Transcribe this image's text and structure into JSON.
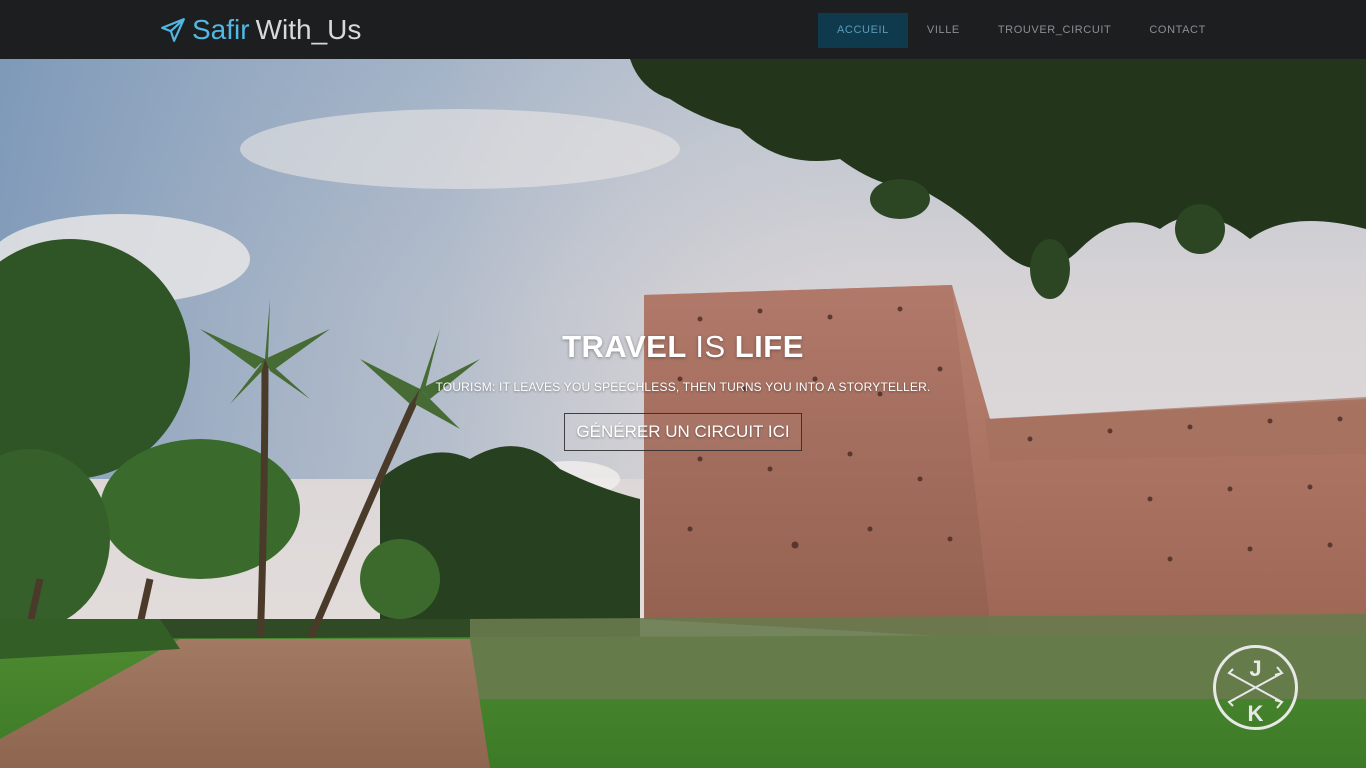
{
  "brand": {
    "name_accent": "Safir",
    "name_rest": "With_Us",
    "icon": "paper-plane-icon"
  },
  "nav": {
    "items": [
      {
        "label": "ACCUEIL",
        "active": true
      },
      {
        "label": "VILLE",
        "active": false
      },
      {
        "label": "TROUVER_CIRCUIT",
        "active": false
      },
      {
        "label": "CONTACT",
        "active": false
      }
    ]
  },
  "hero": {
    "title_word1": "TRAVEL",
    "title_word2": "IS",
    "title_word3": "LIFE",
    "subtitle": "TOURISM: IT LEAVES YOU SPEECHLESS, THEN TURNS YOU INTO A STORYTELLER.",
    "button_label": "GÉNÉRER UN CIRCUIT ICI"
  },
  "watermark": {
    "letter_top": "J",
    "letter_bottom": "K"
  },
  "colors": {
    "navbar_bg": "#1d1e1f",
    "brand_accent": "#52b7e3",
    "nav_active_bg": "#0f3a4d"
  }
}
